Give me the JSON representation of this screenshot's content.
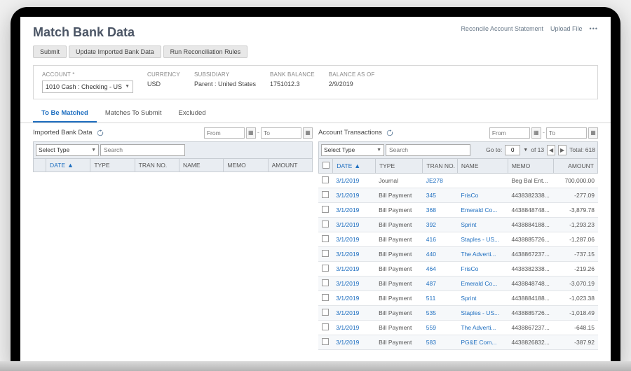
{
  "page": {
    "title": "Match Bank Data"
  },
  "topLinks": {
    "reconcile": "Reconcile Account Statement",
    "upload": "Upload File"
  },
  "buttons": {
    "submit": "Submit",
    "update": "Update Imported Bank Data",
    "runRules": "Run Reconciliation Rules"
  },
  "criteria": {
    "account": {
      "label": "ACCOUNT",
      "value": "1010 Cash : Checking - US"
    },
    "currency": {
      "label": "CURRENCY",
      "value": "USD"
    },
    "subsidiary": {
      "label": "SUBSIDIARY",
      "value": "Parent : United States"
    },
    "bankBalance": {
      "label": "BANK BALANCE",
      "value": "1751012.3"
    },
    "balanceAsOf": {
      "label": "BALANCE AS OF",
      "value": "2/9/2019"
    }
  },
  "tabs": [
    "To Be Matched",
    "Matches To Submit",
    "Excluded"
  ],
  "left": {
    "title": "Imported Bank Data",
    "fromPh": "From",
    "toPh": "To",
    "selectType": "Select Type",
    "searchPh": "Search",
    "columns": [
      "",
      "DATE",
      "TYPE",
      "TRAN NO.",
      "NAME",
      "MEMO",
      "AMOUNT"
    ],
    "rows": []
  },
  "right": {
    "title": "Account Transactions",
    "fromPh": "From",
    "toPh": "To",
    "selectType": "Select Type",
    "searchPh": "Search",
    "pager": {
      "goToLabel": "Go to:",
      "goToVal": "0",
      "ofText": "of 13",
      "totalText": "Total: 618"
    },
    "columns": [
      "",
      "DATE",
      "TYPE",
      "TRAN NO.",
      "NAME",
      "MEMO",
      "AMOUNT"
    ],
    "rows": [
      {
        "date": "3/1/2019",
        "type": "Journal",
        "tran": "JE278",
        "name": "",
        "memo": "Beg Bal Ent...",
        "amount": "700,000.00"
      },
      {
        "date": "3/1/2019",
        "type": "Bill Payment",
        "tran": "345",
        "name": "FrisCo",
        "memo": "4438382338...",
        "amount": "-277.09"
      },
      {
        "date": "3/1/2019",
        "type": "Bill Payment",
        "tran": "368",
        "name": "Emerald Co...",
        "memo": "4438848748...",
        "amount": "-3,879.78"
      },
      {
        "date": "3/1/2019",
        "type": "Bill Payment",
        "tran": "392",
        "name": "Sprint",
        "memo": "4438884188...",
        "amount": "-1,293.23"
      },
      {
        "date": "3/1/2019",
        "type": "Bill Payment",
        "tran": "416",
        "name": "Staples - US...",
        "memo": "4438885726...",
        "amount": "-1,287.06"
      },
      {
        "date": "3/1/2019",
        "type": "Bill Payment",
        "tran": "440",
        "name": "The Adverti...",
        "memo": "4438867237...",
        "amount": "-737.15"
      },
      {
        "date": "3/1/2019",
        "type": "Bill Payment",
        "tran": "464",
        "name": "FrisCo",
        "memo": "4438382338...",
        "amount": "-219.26"
      },
      {
        "date": "3/1/2019",
        "type": "Bill Payment",
        "tran": "487",
        "name": "Emerald Co...",
        "memo": "4438848748...",
        "amount": "-3,070.19"
      },
      {
        "date": "3/1/2019",
        "type": "Bill Payment",
        "tran": "511",
        "name": "Sprint",
        "memo": "4438884188...",
        "amount": "-1,023.38"
      },
      {
        "date": "3/1/2019",
        "type": "Bill Payment",
        "tran": "535",
        "name": "Staples - US...",
        "memo": "4438885726...",
        "amount": "-1,018.49"
      },
      {
        "date": "3/1/2019",
        "type": "Bill Payment",
        "tran": "559",
        "name": "The Adverti...",
        "memo": "4438867237...",
        "amount": "-648.15"
      },
      {
        "date": "3/1/2019",
        "type": "Bill Payment",
        "tran": "583",
        "name": "PG&E Com...",
        "memo": "4438826832...",
        "amount": "-387.92"
      }
    ]
  }
}
